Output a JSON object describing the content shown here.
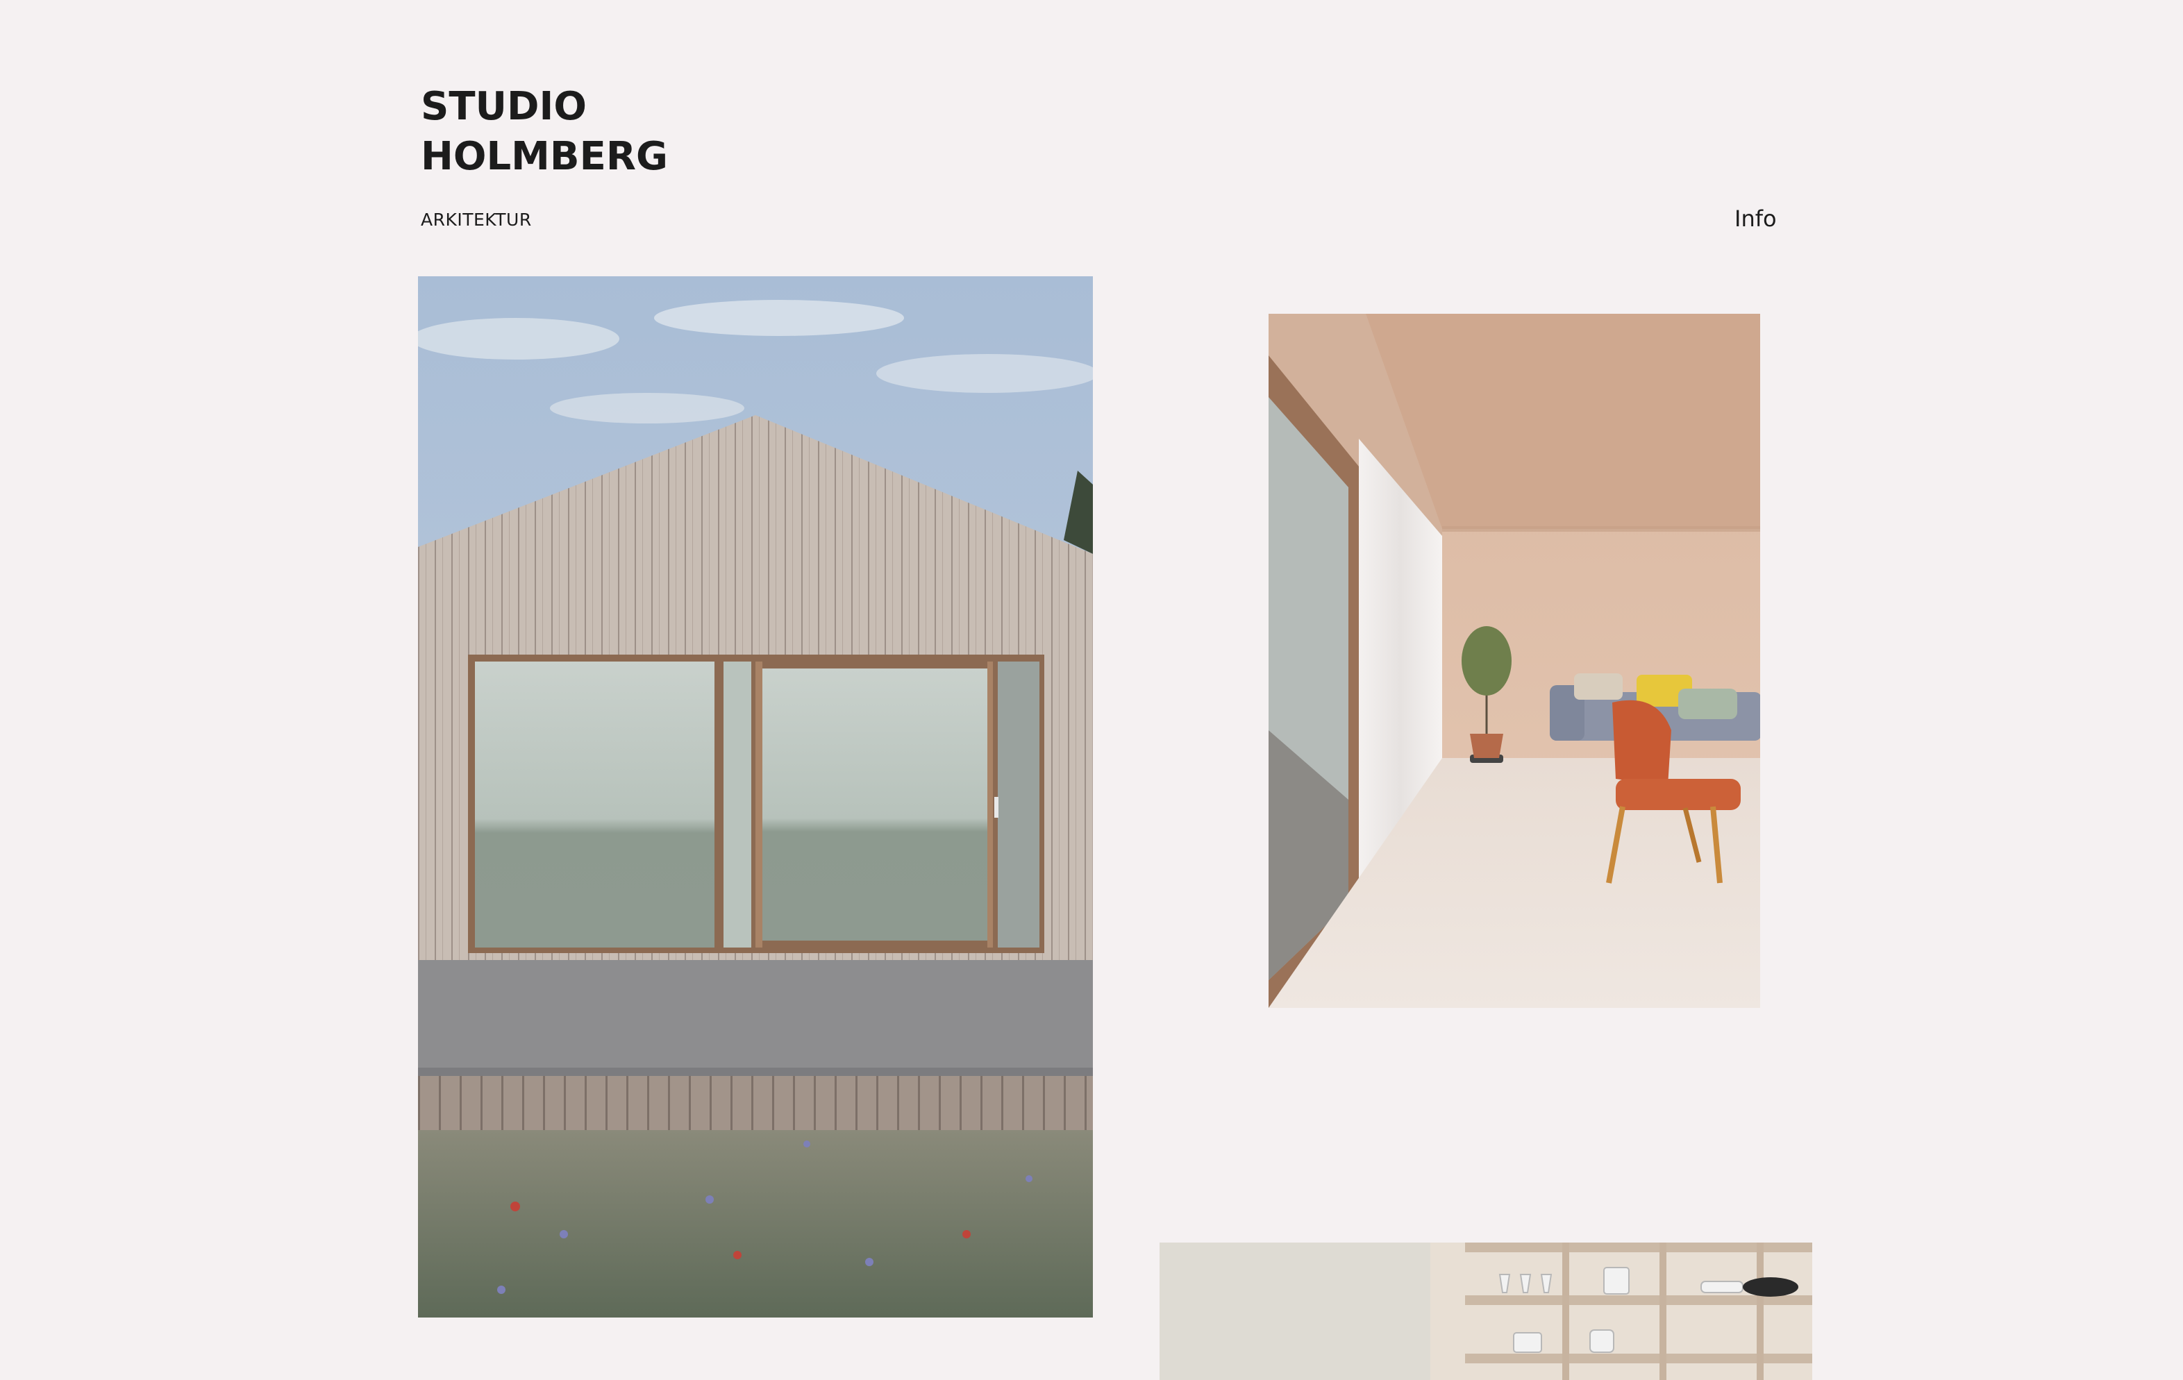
{
  "header": {
    "brand_line1": "STUDIO",
    "brand_line2": "HOLMBERG",
    "tagline": "ARKITEKTUR",
    "nav_info": "Info"
  },
  "gallery": [
    {
      "subject": "timber gable house exterior with sliding glass doors, deck and wildflower meadow"
    },
    {
      "subject": "plywood interior with large window, curtains, olive tree, grey sofa and orange chair"
    },
    {
      "subject": "kitchen with pale wooden open shelving, glasses and dishes"
    }
  ],
  "colors": {
    "background": "#f5f1f2",
    "text": "#1c1c1c"
  }
}
